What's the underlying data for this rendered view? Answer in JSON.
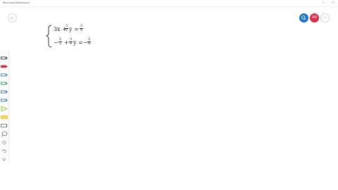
{
  "window": {
    "title": "Microsoft Whiteboard",
    "min_glyph": "–",
    "max_glyph": "□"
  },
  "nav": {
    "back_glyph": "←"
  },
  "header_buttons": {
    "user_label": "AB",
    "more_glyph": "···"
  },
  "colors": {
    "accent_blue": "#1a73c9",
    "accent_red": "#d9304a",
    "ink": "#222222"
  },
  "equations": {
    "eq1_term1": "3x +",
    "eq1_num": "3",
    "eq1_den": "2",
    "eq1_var": "y =",
    "eq1_rhs_num": "3",
    "eq1_rhs_den": "4",
    "eq2_sign": "−",
    "eq2_num1": "5",
    "eq2_den1": "2",
    "eq2_plus": "+",
    "eq2_num2": "3",
    "eq2_den2": "4",
    "eq2_var": "y =",
    "eq2_rhs_sign": "−",
    "eq2_rhs_num": "5",
    "eq2_rhs_den": "4"
  },
  "toolbar": {
    "tools": [
      {
        "name": "pen-black",
        "color": "#222222"
      },
      {
        "name": "pen-red",
        "color": "#d9304a"
      },
      {
        "name": "pen-blue",
        "color": "#1a73c9"
      },
      {
        "name": "pen-green",
        "color": "#1e8a5a"
      },
      {
        "name": "pen-blue-2",
        "color": "#2255aa"
      },
      {
        "name": "pen-teal",
        "color": "#1f6f8b"
      },
      {
        "name": "highlighter-green",
        "color": "#8cc63f"
      },
      {
        "name": "highlighter-yellow",
        "color": "#e8b400"
      },
      {
        "name": "eraser",
        "color": "#555555"
      },
      {
        "name": "lasso",
        "color": "#555555"
      },
      {
        "name": "settings",
        "color": "#888888"
      },
      {
        "name": "undo",
        "color": "#888888"
      },
      {
        "name": "redo",
        "color": "#888888"
      }
    ]
  }
}
